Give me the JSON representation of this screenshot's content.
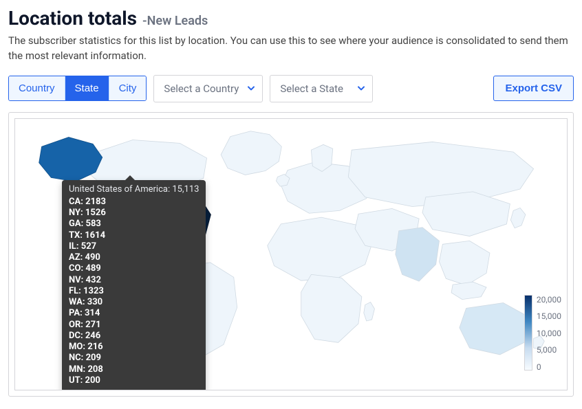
{
  "header": {
    "title": "Location totals",
    "subtitle": "-New Leads",
    "description": "The subscriber statistics for this list by location. You can use this to see where your audience is consolidated to send them the most relevant information."
  },
  "tabs": {
    "country": "Country",
    "state": "State",
    "city": "City",
    "active": "state"
  },
  "selects": {
    "country_placeholder": "Select a Country",
    "state_placeholder": "Select a State"
  },
  "export_label": "Export CSV",
  "tooltip": {
    "header": "United States of America: 15,113",
    "rows": [
      "CA: 2183",
      "NY: 1526",
      "GA: 583",
      "TX: 1614",
      "IL: 527",
      "AZ: 490",
      "CO: 489",
      "NV: 432",
      "FL: 1323",
      "WA: 330",
      "PA: 314",
      "OR: 271",
      "DC: 246",
      "MO: 216",
      "NC: 209",
      "MN: 208",
      "UT: 200"
    ]
  },
  "legend": {
    "ticks": [
      "20,000",
      "15,000",
      "10,000",
      "5,000",
      "0"
    ]
  },
  "chart_data": {
    "type": "heatmap",
    "title": "Location totals - New Leads",
    "scale_min": 0,
    "scale_max": 20000,
    "highlight_country": "United States of America",
    "highlight_total": 15113,
    "states": [
      {
        "code": "CA",
        "value": 2183
      },
      {
        "code": "NY",
        "value": 1526
      },
      {
        "code": "GA",
        "value": 583
      },
      {
        "code": "TX",
        "value": 1614
      },
      {
        "code": "IL",
        "value": 527
      },
      {
        "code": "AZ",
        "value": 490
      },
      {
        "code": "CO",
        "value": 489
      },
      {
        "code": "NV",
        "value": 432
      },
      {
        "code": "FL",
        "value": 1323
      },
      {
        "code": "WA",
        "value": 330
      },
      {
        "code": "PA",
        "value": 314
      },
      {
        "code": "OR",
        "value": 271
      },
      {
        "code": "DC",
        "value": 246
      },
      {
        "code": "MO",
        "value": 216
      },
      {
        "code": "NC",
        "value": 209
      },
      {
        "code": "MN",
        "value": 208
      },
      {
        "code": "UT",
        "value": 200
      }
    ]
  },
  "colors": {
    "accent": "#2563eb",
    "map_dark": "#08306b",
    "map_light": "#f2f8fd"
  }
}
